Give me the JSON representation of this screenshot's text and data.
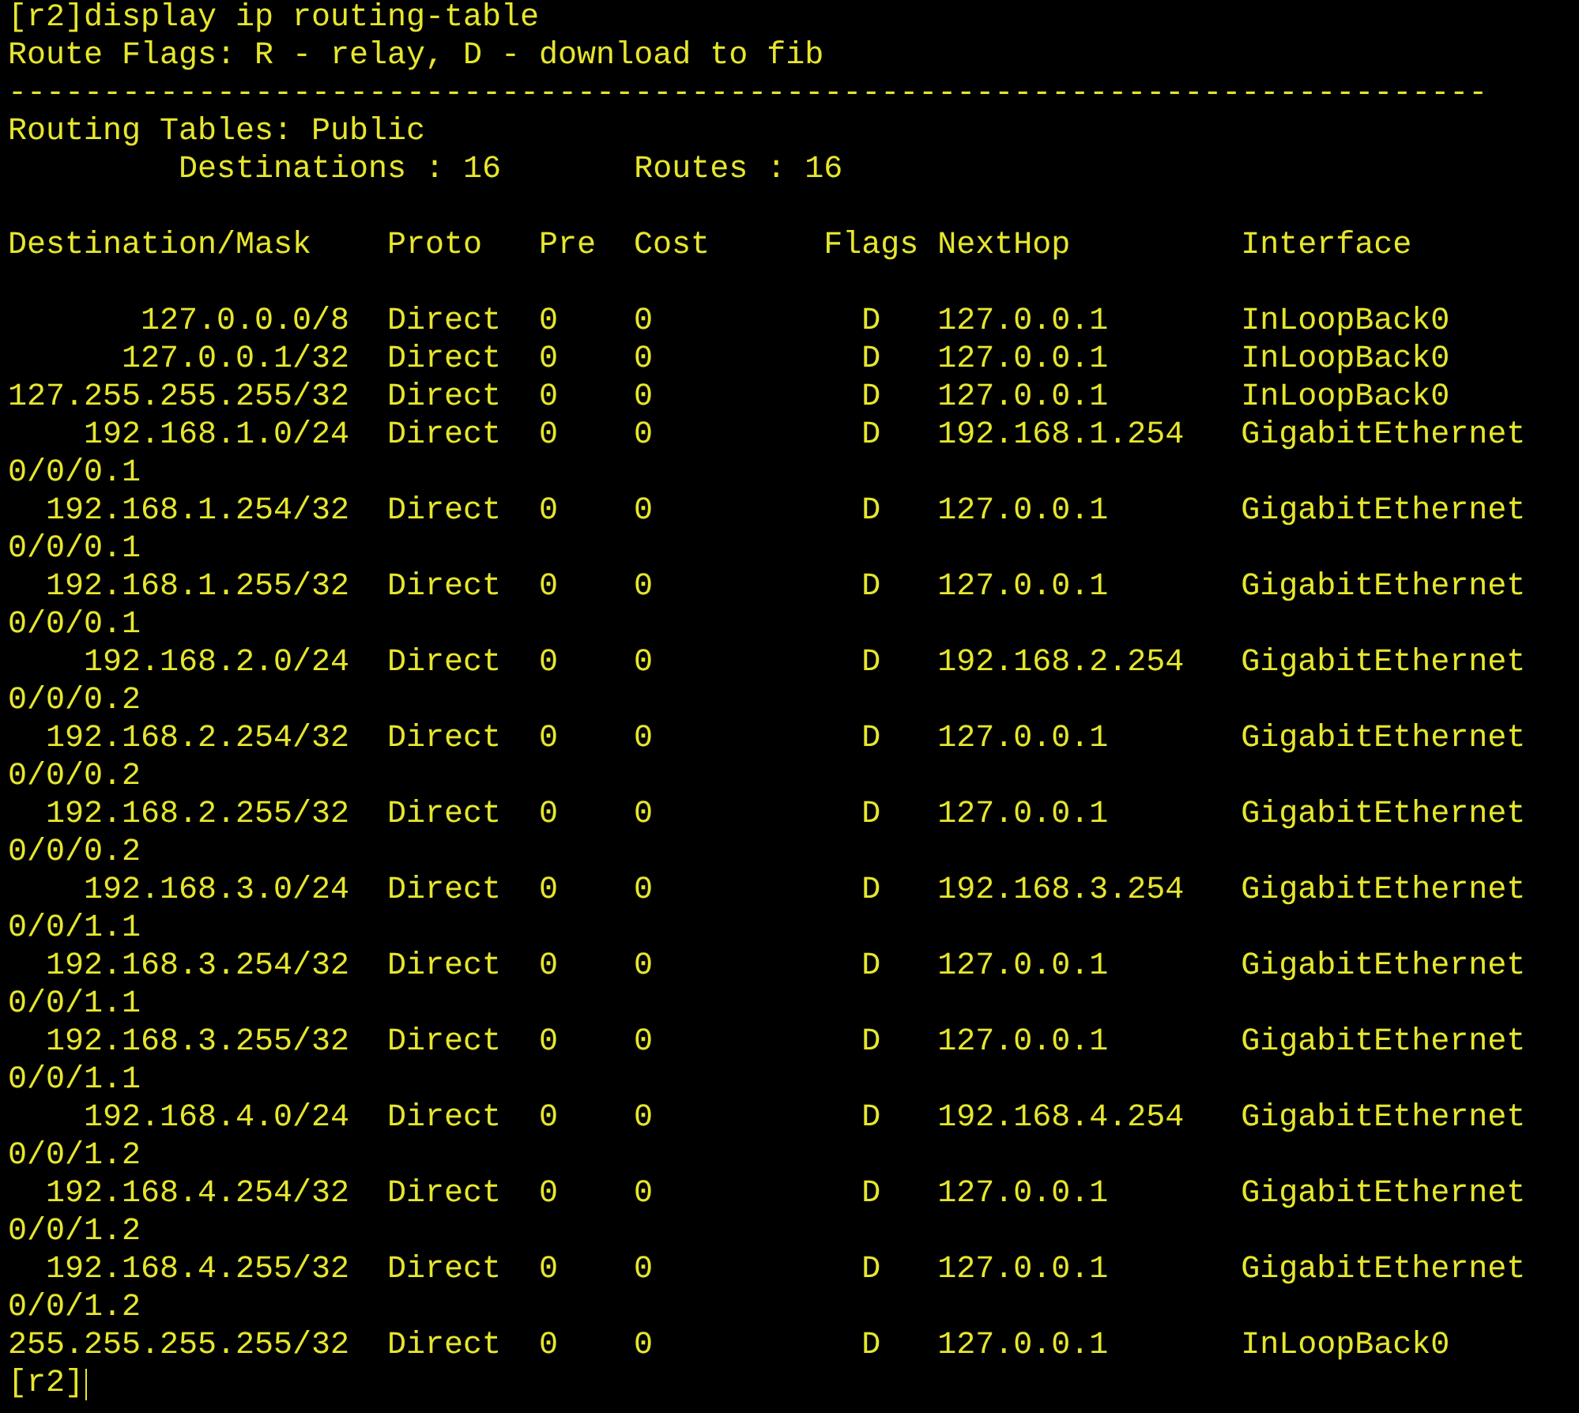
{
  "command": "[r2]display ip routing-table",
  "legend": "Route Flags: R - relay, D - download to fib",
  "separator": "------------------------------------------------------------------------------",
  "table_title": "Routing Tables: Public",
  "summary": [
    "Destinations : 16",
    "Routes : 16"
  ],
  "columns": [
    "Destination/Mask",
    "Proto",
    "Pre",
    "Cost",
    "Flags",
    "NextHop",
    "Interface"
  ],
  "rows": [
    {
      "destination": "127.0.0.0/8",
      "proto": "Direct",
      "pre": "0",
      "cost": "0",
      "flags": "D",
      "nexthop": "127.0.0.1",
      "interface": "InLoopBack0"
    },
    {
      "destination": "127.0.0.1/32",
      "proto": "Direct",
      "pre": "0",
      "cost": "0",
      "flags": "D",
      "nexthop": "127.0.0.1",
      "interface": "InLoopBack0"
    },
    {
      "destination": "127.255.255.255/32",
      "proto": "Direct",
      "pre": "0",
      "cost": "0",
      "flags": "D",
      "nexthop": "127.0.0.1",
      "interface": "InLoopBack0"
    },
    {
      "destination": "192.168.1.0/24",
      "proto": "Direct",
      "pre": "0",
      "cost": "0",
      "flags": "D",
      "nexthop": "192.168.1.254",
      "interface": "GigabitEthernet0/0/0.1"
    },
    {
      "destination": "192.168.1.254/32",
      "proto": "Direct",
      "pre": "0",
      "cost": "0",
      "flags": "D",
      "nexthop": "127.0.0.1",
      "interface": "GigabitEthernet0/0/0.1"
    },
    {
      "destination": "192.168.1.255/32",
      "proto": "Direct",
      "pre": "0",
      "cost": "0",
      "flags": "D",
      "nexthop": "127.0.0.1",
      "interface": "GigabitEthernet0/0/0.1"
    },
    {
      "destination": "192.168.2.0/24",
      "proto": "Direct",
      "pre": "0",
      "cost": "0",
      "flags": "D",
      "nexthop": "192.168.2.254",
      "interface": "GigabitEthernet0/0/0.2"
    },
    {
      "destination": "192.168.2.254/32",
      "proto": "Direct",
      "pre": "0",
      "cost": "0",
      "flags": "D",
      "nexthop": "127.0.0.1",
      "interface": "GigabitEthernet0/0/0.2"
    },
    {
      "destination": "192.168.2.255/32",
      "proto": "Direct",
      "pre": "0",
      "cost": "0",
      "flags": "D",
      "nexthop": "127.0.0.1",
      "interface": "GigabitEthernet0/0/0.2"
    },
    {
      "destination": "192.168.3.0/24",
      "proto": "Direct",
      "pre": "0",
      "cost": "0",
      "flags": "D",
      "nexthop": "192.168.3.254",
      "interface": "GigabitEthernet0/0/1.1"
    },
    {
      "destination": "192.168.3.254/32",
      "proto": "Direct",
      "pre": "0",
      "cost": "0",
      "flags": "D",
      "nexthop": "127.0.0.1",
      "interface": "GigabitEthernet0/0/1.1"
    },
    {
      "destination": "192.168.3.255/32",
      "proto": "Direct",
      "pre": "0",
      "cost": "0",
      "flags": "D",
      "nexthop": "127.0.0.1",
      "interface": "GigabitEthernet0/0/1.1"
    },
    {
      "destination": "192.168.4.0/24",
      "proto": "Direct",
      "pre": "0",
      "cost": "0",
      "flags": "D",
      "nexthop": "192.168.4.254",
      "interface": "GigabitEthernet0/0/1.2"
    },
    {
      "destination": "192.168.4.254/32",
      "proto": "Direct",
      "pre": "0",
      "cost": "0",
      "flags": "D",
      "nexthop": "127.0.0.1",
      "interface": "GigabitEthernet0/0/1.2"
    },
    {
      "destination": "192.168.4.255/32",
      "proto": "Direct",
      "pre": "0",
      "cost": "0",
      "flags": "D",
      "nexthop": "127.0.0.1",
      "interface": "GigabitEthernet0/0/1.2"
    },
    {
      "destination": "255.255.255.255/32",
      "proto": "Direct",
      "pre": "0",
      "cost": "0",
      "flags": "D",
      "nexthop": "127.0.0.1",
      "interface": "InLoopBack0"
    }
  ],
  "prompt": "[r2]"
}
